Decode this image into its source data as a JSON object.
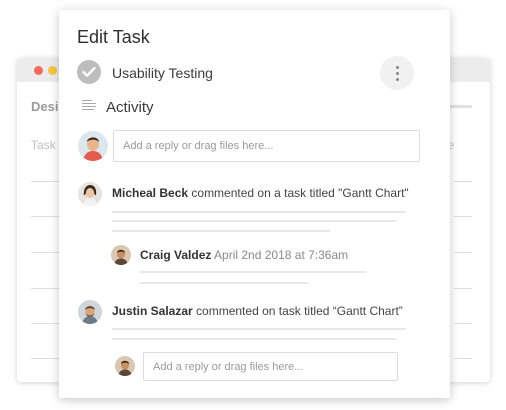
{
  "background_window": {
    "title": "Desi",
    "column_left": "Task",
    "column_right": "e",
    "colors": {
      "close": "#f26b5b",
      "minimize": "#f6c343"
    }
  },
  "modal": {
    "title": "Edit Task",
    "task_name": "Usability Testing",
    "task_icon": "check-circle-icon",
    "more_icon": "vertical-dots-icon",
    "activity_label": "Activity",
    "activity_icon": "lines-icon"
  },
  "reply_top": {
    "placeholder": "Add a reply or drag files here..."
  },
  "comments": [
    {
      "author": "Micheal Beck",
      "action": "commented on a task titled \"Gantt Chart\"",
      "reply": {
        "author": "Craig Valdez",
        "time": "April 2nd 2018 at 7:36am"
      }
    },
    {
      "author": "Justin Salazar",
      "action": "commented on task titled “Gantt Chart”"
    }
  ],
  "reply_bottom": {
    "placeholder": "Add a reply or drag files here..."
  }
}
